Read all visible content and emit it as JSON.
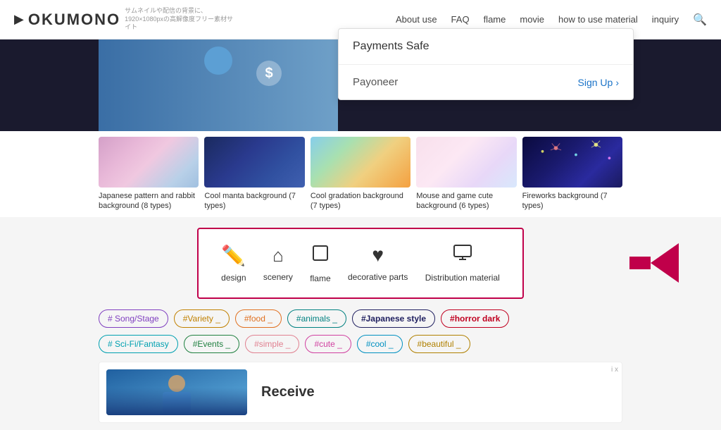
{
  "header": {
    "logo_text": "OKUMONO",
    "logo_subtitle": "サムネイルや配信の背景に、\n1920×1080pxの高解像度フリー素材サイト",
    "nav_items": [
      "About use",
      "FAQ",
      "flame",
      "movie",
      "how to use material",
      "inquiry"
    ]
  },
  "dropdown": {
    "top_text": "Payments Safe",
    "payoneer_text": "Payoneer",
    "signup_text": "Sign Up",
    "signup_arrow": "›"
  },
  "thumbnails": [
    {
      "label": "Japanese pattern and rabbit background (8 types)",
      "class": "thumb-1"
    },
    {
      "label": "Cool manta background (7 types)",
      "class": "thumb-2"
    },
    {
      "label": "Cool gradation background (7 types)",
      "class": "thumb-3"
    },
    {
      "label": "Mouse and game cute background (6 types)",
      "class": "thumb-4"
    },
    {
      "label": "Fireworks background (7 types)",
      "class": "thumb-5"
    }
  ],
  "categories": [
    {
      "icon": "✏",
      "label": "design"
    },
    {
      "icon": "⌂",
      "label": "scenery"
    },
    {
      "icon": "▭",
      "label": "flame"
    },
    {
      "icon": "♥",
      "label": "decorative parts"
    },
    {
      "icon": "🖥",
      "label": "Distribution\nmaterial"
    }
  ],
  "tags_row1": [
    {
      "text": "# Song/Stage",
      "class": "tag-purple"
    },
    {
      "text": "#Variety _",
      "class": "tag-yellow"
    },
    {
      "text": "#food _",
      "class": "tag-orange"
    },
    {
      "text": "#animals _",
      "class": "tag-teal"
    },
    {
      "text": "#Japanese style",
      "class": "tag-darkblue"
    },
    {
      "text": "#horror dark",
      "class": "tag-red"
    }
  ],
  "tags_row2": [
    {
      "text": "# Sci-Fi/Fantasy",
      "class": "tag-cyan"
    },
    {
      "text": "#Events _",
      "class": "tag-green"
    },
    {
      "text": "#simple _",
      "class": "tag-lightpink"
    },
    {
      "text": "#cute _",
      "class": "tag-pink"
    },
    {
      "text": "#cool _",
      "class": "tag-sky"
    },
    {
      "text": "#beautiful _",
      "class": "tag-gold"
    }
  ],
  "bottom": {
    "receive_title": "Receive",
    "ad_text": "i x"
  }
}
